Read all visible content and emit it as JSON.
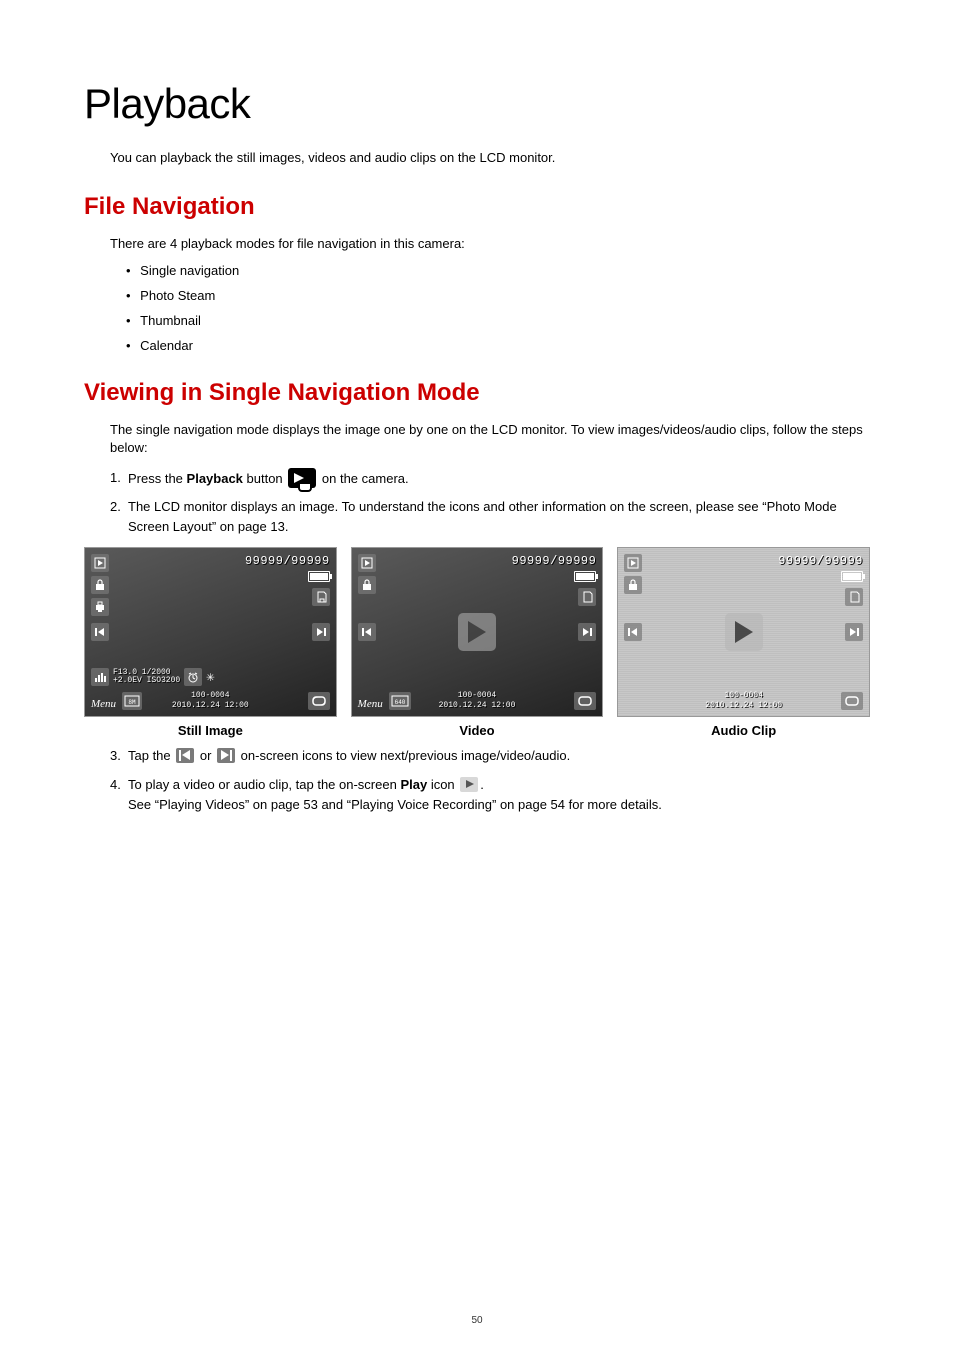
{
  "page": {
    "title": "Playback",
    "intro": "You can playback the still images, videos and audio clips on the LCD monitor.",
    "number": "50"
  },
  "section1": {
    "heading": "File Navigation",
    "lead": "There are 4 playback modes for file navigation in this camera:",
    "modes": [
      "Single navigation",
      "Photo Steam",
      "Thumbnail",
      "Calendar"
    ]
  },
  "section2": {
    "heading": "Viewing in Single Navigation Mode",
    "lead": "The single navigation mode displays the image one by one on the LCD monitor.  To view images/videos/audio clips, follow the steps below:",
    "step1_a": "Press the  ",
    "step1_b": "Playback",
    "step1_c": " button ",
    "step1_d": " on the camera.",
    "step2": "The LCD monitor displays an image. To understand the icons and other information on the screen, please see “Photo Mode Screen Layout” on page 13.",
    "step3_a": "Tap the ",
    "step3_b": " or ",
    "step3_c": " on-screen icons to view next/previous image/video/audio.",
    "step4_a": "To play a video or audio clip, tap the on-screen ",
    "step4_b": "Play",
    "step4_c": " icon ",
    "step4_d": ".",
    "step4_sub": "See “Playing Videos” on page 53 and “Playing Voice Recording” on page 54 for more details."
  },
  "shots": {
    "counter": "99999/99999",
    "file": "100-0004",
    "datetime": "2010.12.24 12:00",
    "menu": "Menu",
    "exposure_line1": "F13.0  1/2000",
    "exposure_line2": "+2.0EV ISO3200",
    "video_res": "640",
    "captions": {
      "still": "Still Image",
      "video": "Video",
      "audio": "Audio Clip"
    }
  }
}
